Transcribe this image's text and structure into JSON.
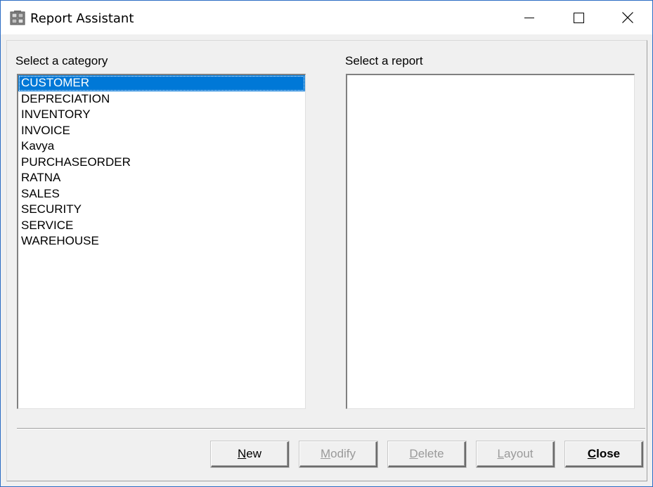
{
  "window": {
    "title": "Report Assistant",
    "controls": [
      "minimize-icon",
      "maximize-icon",
      "close-icon"
    ]
  },
  "category": {
    "label": "Select a category",
    "items": [
      "CUSTOMER",
      "DEPRECIATION",
      "INVENTORY",
      "INVOICE",
      "Kavya",
      "PURCHASEORDER",
      "RATNA",
      "SALES",
      "SECURITY",
      "SERVICE",
      "WAREHOUSE"
    ],
    "selected": "CUSTOMER"
  },
  "report": {
    "label": "Select a report",
    "items": []
  },
  "buttons": {
    "new": {
      "mnemonic": "N",
      "rest": "ew",
      "enabled": true
    },
    "modify": {
      "mnemonic": "M",
      "rest": "odify",
      "enabled": false
    },
    "delete": {
      "mnemonic": "D",
      "rest": "elete",
      "enabled": false
    },
    "layout": {
      "mnemonic": "L",
      "rest": "ayout",
      "enabled": false
    },
    "close": {
      "mnemonic": "C",
      "rest": "lose",
      "enabled": true
    }
  },
  "colors": {
    "selection": "#0078d7",
    "window_border": "#2b6cc4",
    "disabled_text": "#9a9a9a"
  }
}
